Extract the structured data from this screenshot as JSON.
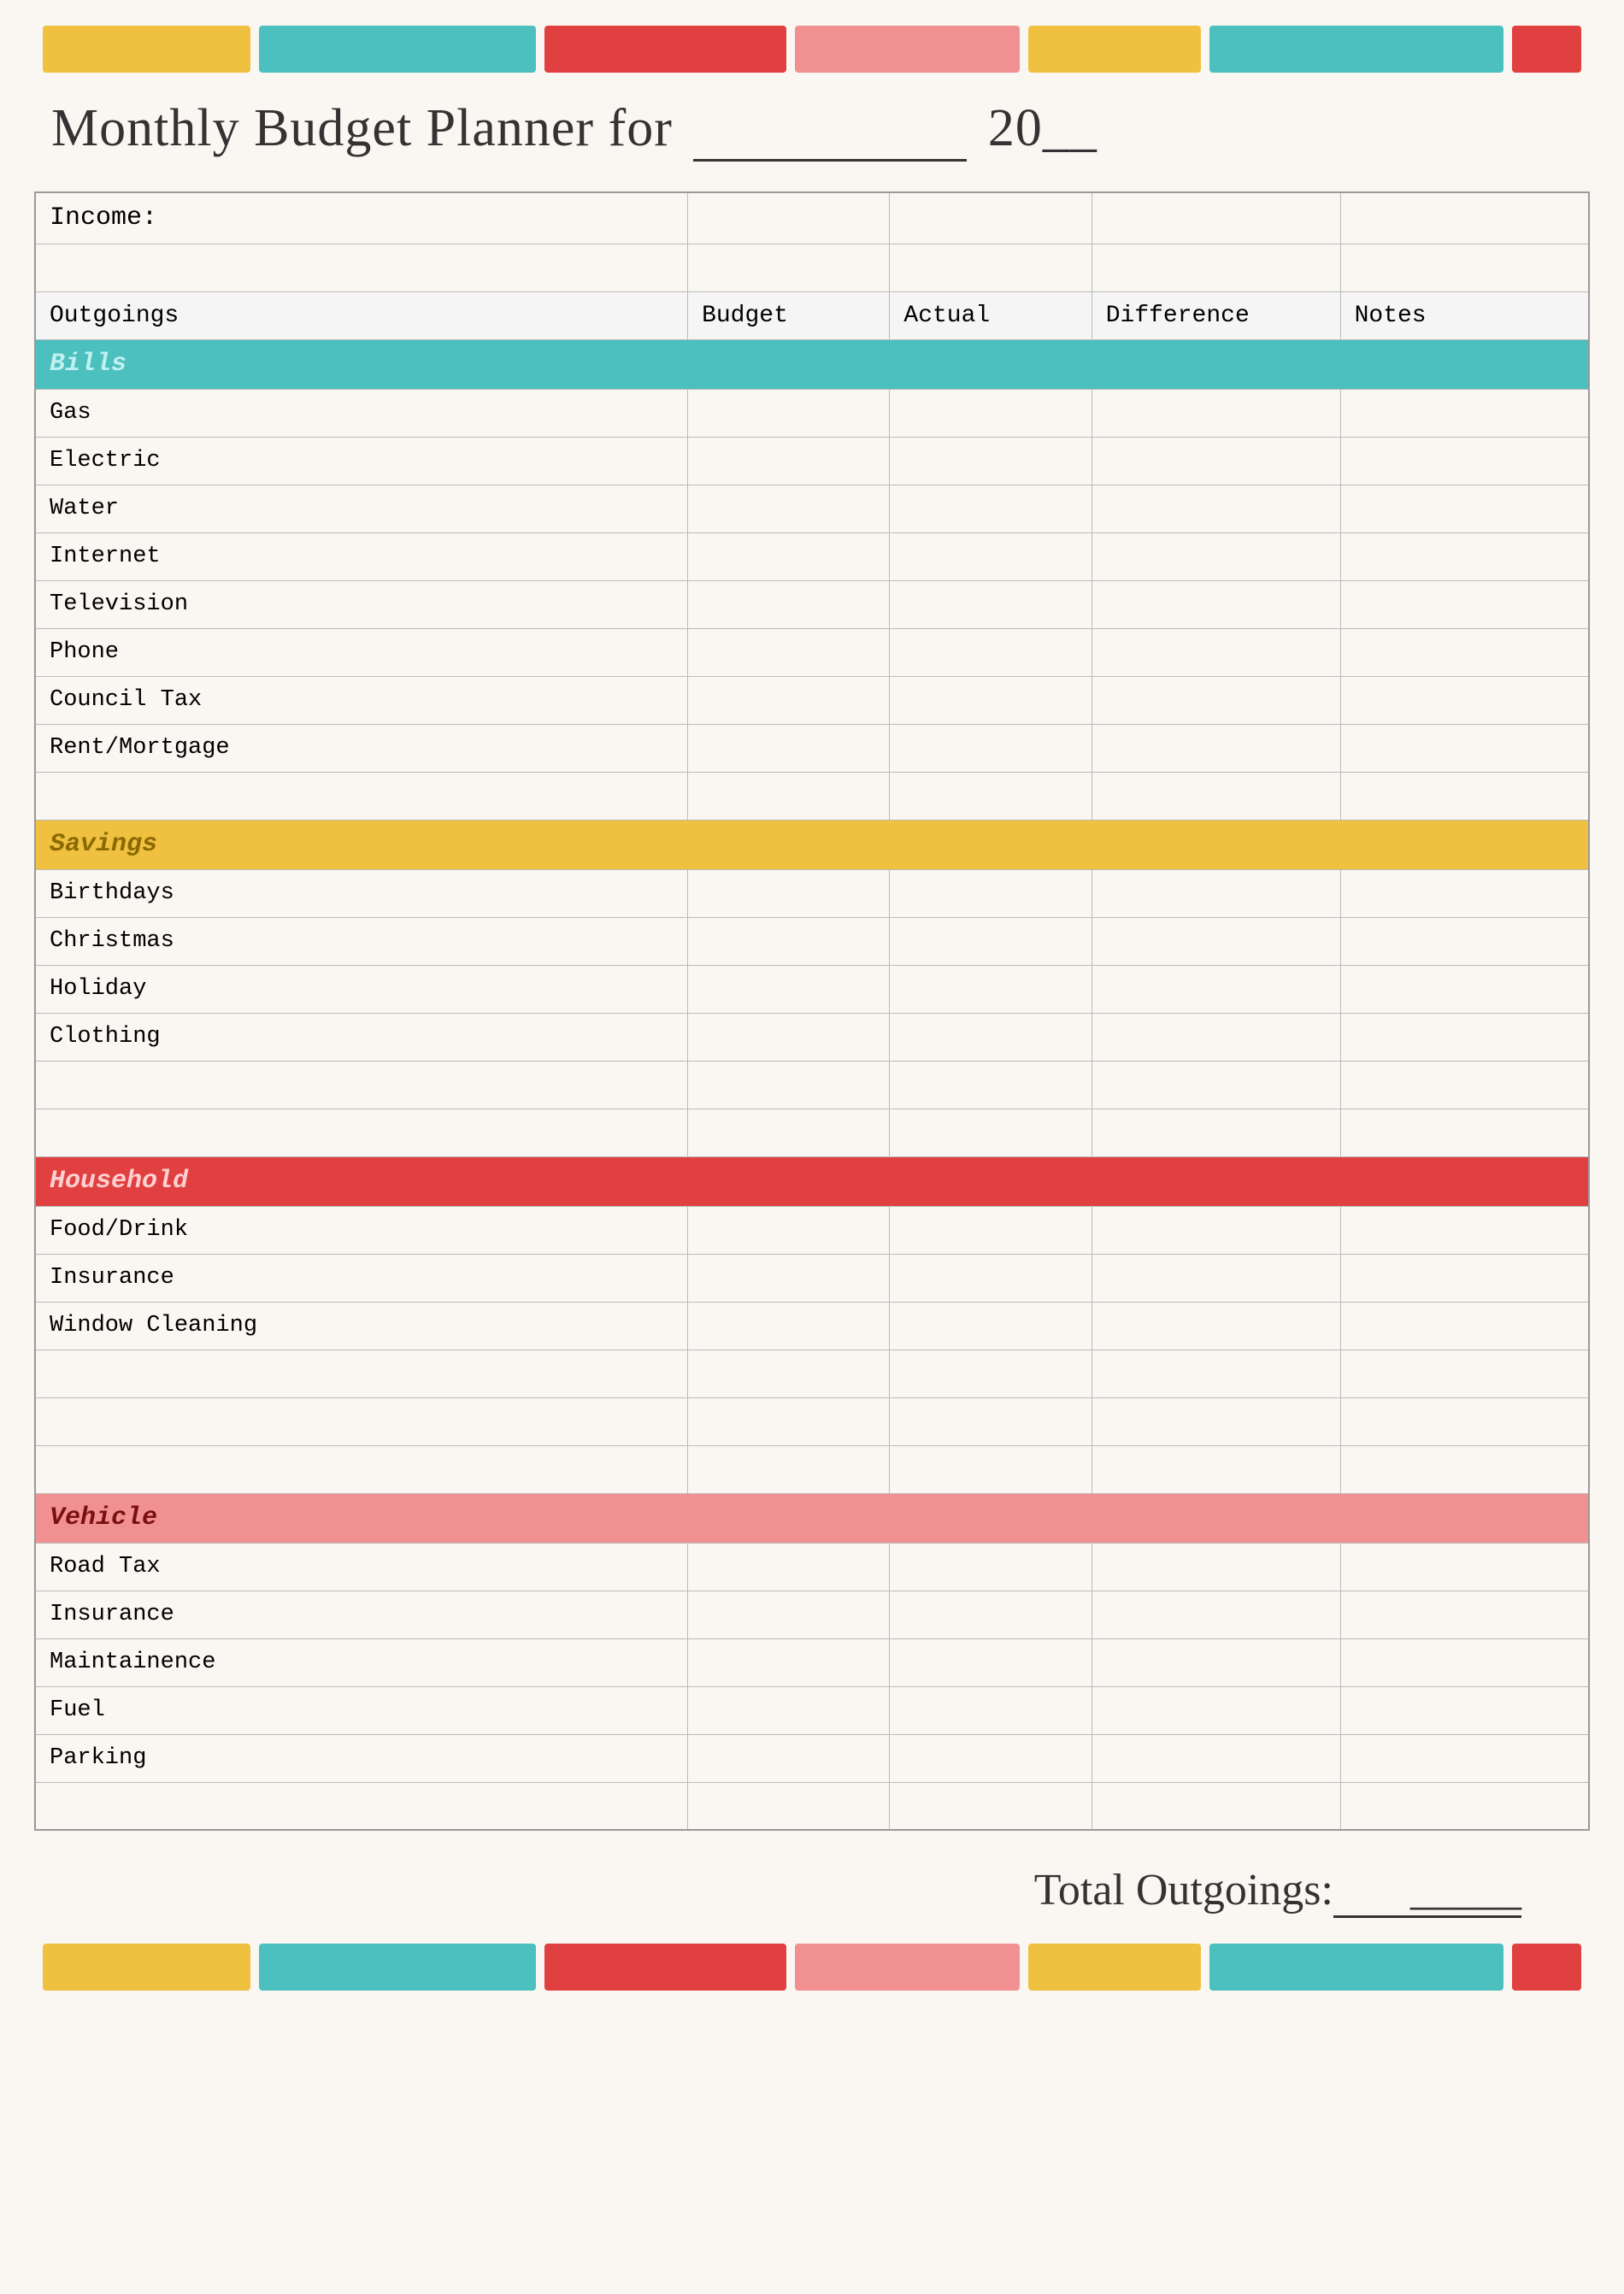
{
  "title": {
    "prefix": "Monthly Budget Planner for",
    "year_prefix": "20",
    "year_blank": "__"
  },
  "income_label": "Income:",
  "headers": {
    "outgoings": "Outgoings",
    "budget": "Budget",
    "actual": "Actual",
    "difference": "Difference",
    "notes": "Notes"
  },
  "sections": [
    {
      "name": "bills",
      "label": "Bills",
      "color_class": "cat-bills",
      "items": [
        "Gas",
        "Electric",
        "Water",
        "Internet",
        "Television",
        "Phone",
        "Council Tax",
        "Rent/Mortgage"
      ],
      "extra_empty_rows": 1
    },
    {
      "name": "savings",
      "label": "Savings",
      "color_class": "cat-savings",
      "items": [
        "Birthdays",
        "Christmas",
        "Holiday",
        "Clothing"
      ],
      "extra_empty_rows": 2
    },
    {
      "name": "household",
      "label": "Household",
      "color_class": "cat-household",
      "items": [
        "Food/Drink",
        "Insurance",
        "Window Cleaning"
      ],
      "extra_empty_rows": 3
    },
    {
      "name": "vehicle",
      "label": "Vehicle",
      "color_class": "cat-vehicle",
      "items": [
        "Road Tax",
        "Insurance",
        "Maintainence",
        "Fuel",
        "Parking"
      ],
      "extra_empty_rows": 1
    }
  ],
  "total_label": "Total Outgoings:",
  "total_blank": "_____",
  "colors": {
    "yellow": "#f0c040",
    "teal": "#4cbfbf",
    "red": "#e04040",
    "pink": "#f09090"
  }
}
